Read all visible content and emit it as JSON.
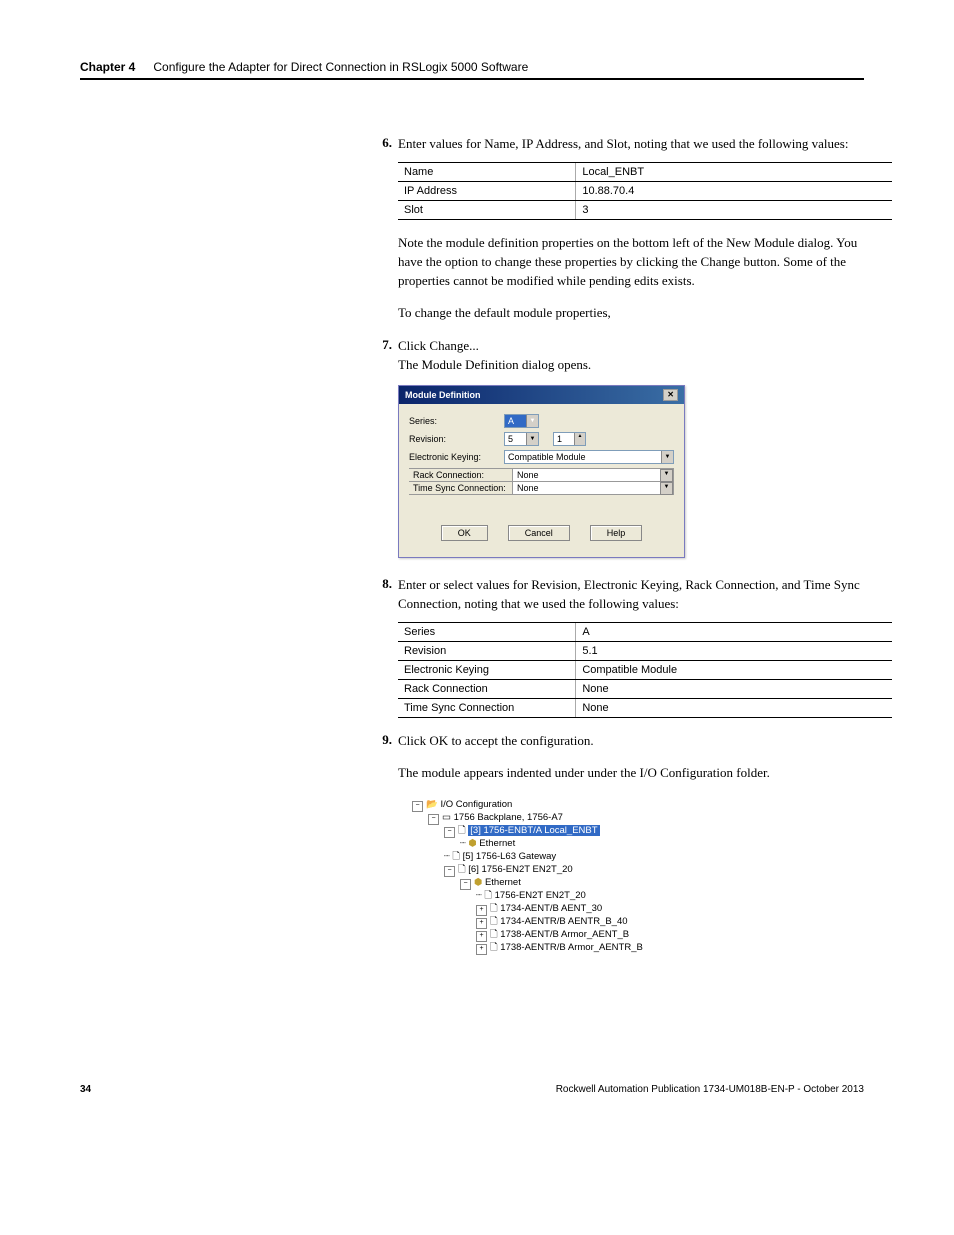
{
  "header": {
    "chapter_label": "Chapter 4",
    "chapter_title": "Configure the Adapter for Direct Connection in RSLogix 5000 Software"
  },
  "steps": {
    "s6": {
      "num": "6.",
      "text": "Enter values for Name, IP Address, and Slot, noting that we used the following values:"
    },
    "s7": {
      "num": "7.",
      "text": "Click Change...",
      "sub": "The Module Definition dialog opens."
    },
    "s8": {
      "num": "8.",
      "text": "Enter or select values for Revision, Electronic Keying, Rack Connection, and Time Sync Connection, noting that we used the following values:"
    },
    "s9": {
      "num": "9.",
      "text": "Click OK to accept the configuration."
    }
  },
  "table1": {
    "r1k": "Name",
    "r1v": "Local_ENBT",
    "r2k": "IP Address",
    "r2v": "10.88.70.4",
    "r3k": "Slot",
    "r3v": "3"
  },
  "note1": "Note the module definition properties on the bottom left of the New Module dialog. You have the option to change these properties by clicking the Change button. Some of the properties cannot be modified while pending edits exists.",
  "note2": "To change the default module properties,",
  "note3": "The module appears indented under under the I/O Configuration folder.",
  "dialog": {
    "title": "Module Definition",
    "close": "✕",
    "series_label": "Series:",
    "series_value": "A",
    "revision_label": "Revision:",
    "revision_value": "5",
    "revision_minor": "1",
    "keying_label": "Electronic Keying:",
    "keying_value": "Compatible Module",
    "rack_label": "Rack Connection:",
    "rack_value": "None",
    "time_label": "Time Sync Connection:",
    "time_value": "None",
    "ok": "OK",
    "cancel": "Cancel",
    "help": "Help"
  },
  "table2": {
    "r1k": "Series",
    "r1v": "A",
    "r2k": "Revision",
    "r2v": "5.1",
    "r3k": "Electronic Keying",
    "r3v": "Compatible Module",
    "r4k": "Rack Connection",
    "r4v": "None",
    "r5k": "Time Sync Connection",
    "r5v": "None"
  },
  "tree": {
    "root": "I/O Configuration",
    "n1": "1756 Backplane, 1756-A7",
    "n2": "[3] 1756-ENBT/A Local_ENBT",
    "n3": "Ethernet",
    "n4": "[5] 1756-L63 Gateway",
    "n5": "[6] 1756-EN2T EN2T_20",
    "n6": "Ethernet",
    "n7": "1756-EN2T EN2T_20",
    "n8": "1734-AENT/B AENT_30",
    "n9": "1734-AENTR/B AENTR_B_40",
    "n10": "1738-AENT/B Armor_AENT_B",
    "n11": "1738-AENTR/B Armor_AENTR_B"
  },
  "footer": {
    "page_num": "34",
    "pub": "Rockwell Automation Publication 1734-UM018B-EN-P - October 2013"
  }
}
